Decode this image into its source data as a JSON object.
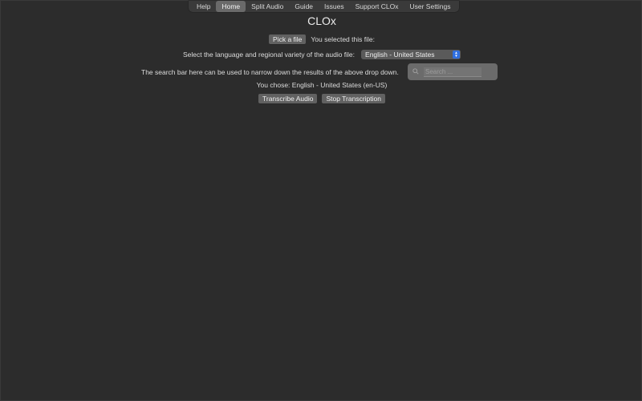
{
  "tabs": [
    {
      "label": "Help",
      "active": false
    },
    {
      "label": "Home",
      "active": true
    },
    {
      "label": "Split Audio",
      "active": false
    },
    {
      "label": "Guide",
      "active": false
    },
    {
      "label": "Issues",
      "active": false
    },
    {
      "label": "Support CLOx",
      "active": false
    },
    {
      "label": "User Settings",
      "active": false
    }
  ],
  "main": {
    "title": "CLOx",
    "pick_file_label": "Pick a file",
    "selected_file_text": "You selected this file:",
    "language_prompt": "Select the language and regional variety of the audio file:",
    "language_selected": "English - United States",
    "search_hint": "The search bar here can be used to narrow down the results of the above drop down.",
    "search_placeholder": "Search ...",
    "chosen_text": "You chose: English - United States (en-US)",
    "transcribe_label": "Transcribe Audio",
    "stop_label": "Stop Transcription"
  },
  "icons": {
    "select_arrows": "up-down-chevron-icon",
    "search": "magnifier-icon"
  },
  "colors": {
    "background": "#2c2c2c",
    "accent": "#2f6fe0",
    "button": "#616161"
  }
}
